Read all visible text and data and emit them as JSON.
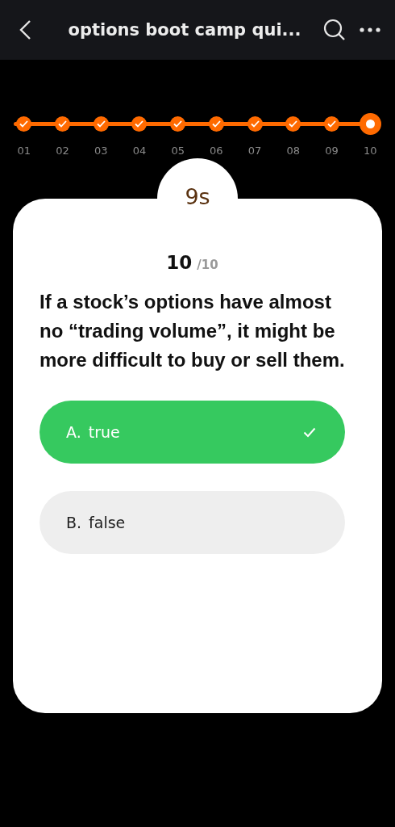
{
  "header": {
    "title": "options boot camp qui..."
  },
  "progress": {
    "steps": [
      {
        "label": "01",
        "kind": "done"
      },
      {
        "label": "02",
        "kind": "done"
      },
      {
        "label": "03",
        "kind": "done"
      },
      {
        "label": "04",
        "kind": "done"
      },
      {
        "label": "05",
        "kind": "done"
      },
      {
        "label": "06",
        "kind": "done"
      },
      {
        "label": "07",
        "kind": "done"
      },
      {
        "label": "08",
        "kind": "done"
      },
      {
        "label": "09",
        "kind": "done"
      },
      {
        "label": "10",
        "kind": "current"
      }
    ]
  },
  "quiz": {
    "timer": "9s",
    "number": "10",
    "total": "/10",
    "question": "If a stock’s options have almost no “trading volume”, it might be more difficult to buy or sell them.",
    "options": [
      {
        "letter": "A.",
        "text": "true",
        "selected": true
      },
      {
        "letter": "B.",
        "text": "false",
        "selected": false
      }
    ]
  }
}
